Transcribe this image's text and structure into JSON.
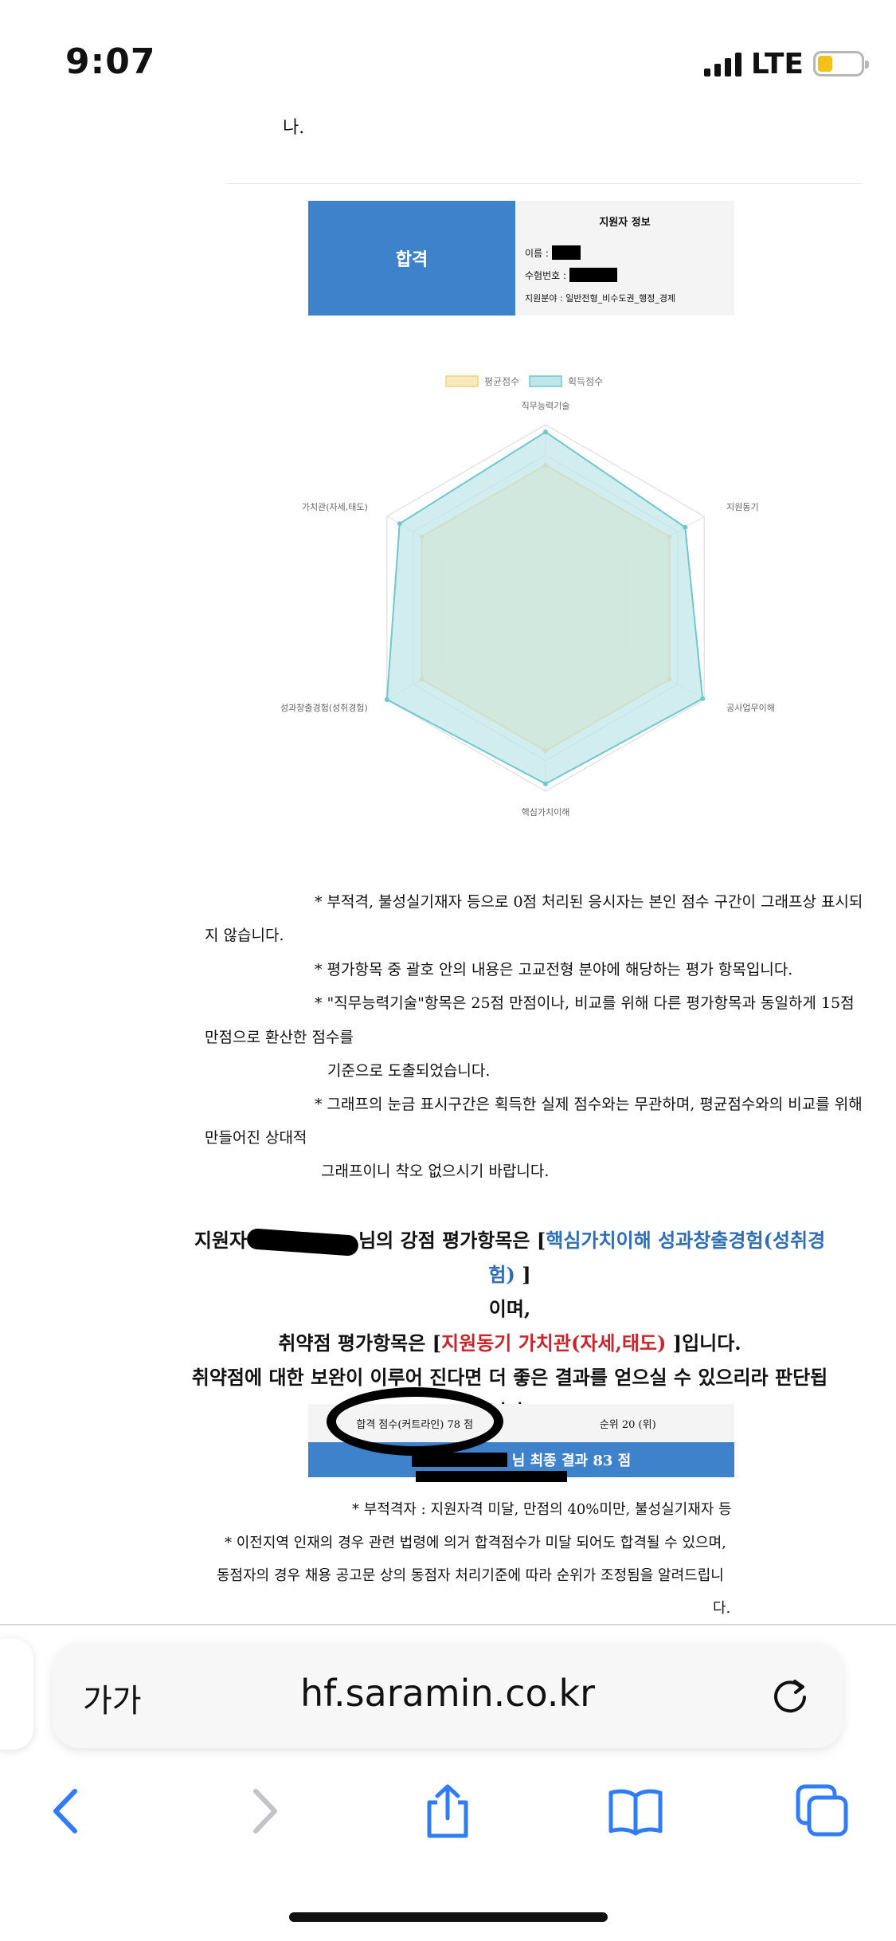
{
  "status_bar": {
    "time": "9:07",
    "network": "LTE"
  },
  "document": {
    "top_text": "나.",
    "result_label": "합격",
    "applicant": {
      "title": "지원자 정보",
      "name_label": "이름 :",
      "exam_no_label": "수험번호 :",
      "field": "지원분야 : 일반전형_비수도권_행정_경제"
    },
    "chart_data": {
      "type": "radar",
      "legend": [
        "평균점수",
        "획득점수"
      ],
      "axes": [
        "직무능력기술",
        "지원동기",
        "공사업무이해",
        "핵심가치이해",
        "성과창출경험(성취경험)",
        "가치관(자세,태도)"
      ],
      "series": [
        {
          "name": "평균점수",
          "values": [
            0.78,
            0.78,
            0.78,
            0.78,
            0.78,
            0.78
          ],
          "color": "#f3d27a",
          "fill": "#f7ebbd"
        },
        {
          "name": "획득점수",
          "values": [
            0.96,
            0.88,
            0.99,
            0.96,
            1.0,
            0.92
          ],
          "color": "#6fc8cc",
          "fill": "#bfe6e8"
        }
      ],
      "legend_position": "top"
    },
    "notes": [
      "* 부적격, 불성실기재자 등으로 0점 처리된 응시자는 본인 점수 구간이 그래프상 표시되",
      "지 않습니다.",
      "* 평가항목 중 괄호 안의 내용은 고교전형 분야에 해당하는 평가 항목입니다.",
      "* \"직무능력기술\"항목은 25점 만점이나, 비교를 위해 다른 평가항목과 동일하게 15점",
      "만점으로 환산한 점수를",
      "기준으로 도출되었습니다.",
      "* 그래프의 눈금 표시구간은 획득한 실제 점수와는 무관하며, 평균점수와의 비교를 위해",
      "만들어진 상대적",
      "그래프이니 착오 없으시기 바랍니다."
    ],
    "summary": {
      "line1_prefix": "지원자",
      "line1_mid": "님의 강점 평가항목은 [",
      "strengths": "핵심가치이해 성과창출경험(성취경험)",
      "line1_suffix": " ]",
      "line2": "이며,",
      "line3_prefix": "취약점 평가항목은 [",
      "weaknesses": "지원동기 가치관(자세,태도)",
      "line3_suffix": " ]입니다.",
      "line4": "취약점에 대한 보완이 이루어 진다면 더 좋은 결과를 얻으실 수 있으리라 판단됩니다."
    },
    "score_table": {
      "cutline": "합격 점수(커트라인) 78 점",
      "rank": "순위 20 (위)",
      "final_result": "님 최종 결과 83 점"
    },
    "footnotes": [
      "* 부적격자 : 지원자격 미달, 만점의 40%미만, 불성실기재자 등",
      "* 이전지역 인재의 경우 관련 법령에 의거 합격점수가 미달 되어도 합격될 수 있으며,",
      "동점자의 경우 채용 공고문 상의 동점자 처리기준에 따라 순위가 조정됨을 알려드립니",
      "다."
    ]
  },
  "browser": {
    "text_size_label": "가가",
    "url": "hf.saramin.co.kr",
    "toolbar": [
      "back-icon",
      "forward-icon",
      "share-icon",
      "bookmarks-icon",
      "tabs-icon"
    ],
    "accent": "#2f7cf6"
  }
}
